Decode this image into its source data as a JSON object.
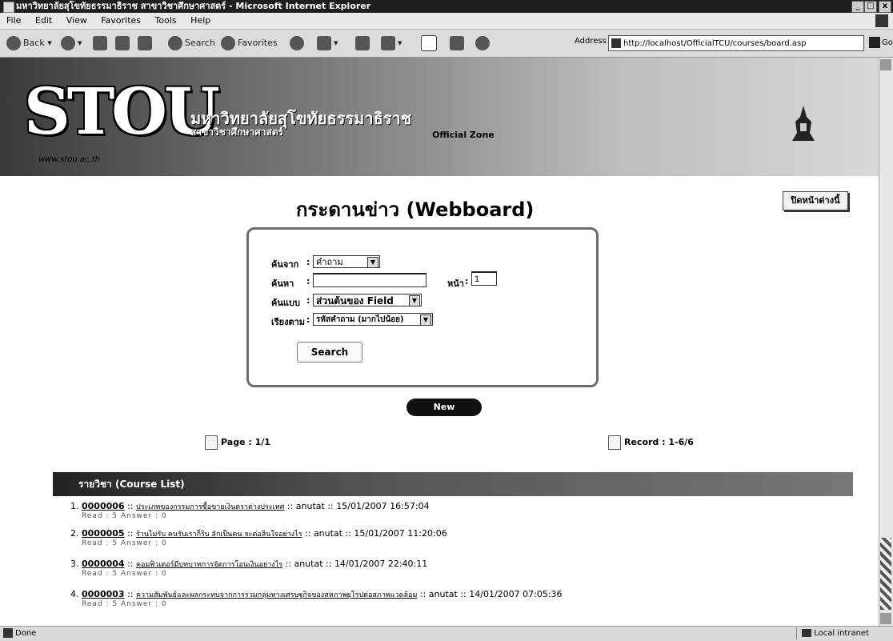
{
  "window": {
    "title": "มหาวิทยาลัยสุโขทัยธรรมาธิราช สาขาวิชาศึกษาศาสตร์ - Microsoft Internet Explorer",
    "min": "_",
    "max": "□",
    "close": "x"
  },
  "menu": [
    "File",
    "Edit",
    "View",
    "Favorites",
    "Tools",
    "Help"
  ],
  "toolbar": {
    "back": "Back",
    "search": "Search",
    "favorites": "Favorites",
    "address_label": "Address",
    "address": "http://localhost/OfficialTCU/courses/board.asp",
    "go": "Go"
  },
  "banner": {
    "logo": "STOU",
    "site_url": "www.stou.ac.th",
    "university": "มหาวิทยาลัยสุโขทัยธรรมาธิราช",
    "school": "สาขาวิชาศึกษาศาสตร์",
    "zone": "Official Zone"
  },
  "page": {
    "title": "กระดานข่าว (Webboard)",
    "print_button": "ปิดหน้าต่างนี้"
  },
  "search": {
    "from_label": "ค้นจาก",
    "from_value": "คำถาม",
    "find_label": "ค้นหา",
    "find_value": "",
    "page_label": "หน้า",
    "page_value": "1",
    "mode_label": "ค้นแบบ",
    "mode_value": "ส่วนต้นของ Field",
    "sort_label": "เรียงตาม",
    "sort_value": "รหัสคำถาม (มากไปน้อย)",
    "button": "Search"
  },
  "new_button": "New",
  "paging": {
    "page": "Page : 1/1",
    "record": "Record : 1-6/6"
  },
  "course_list": {
    "header": "รายวิชา (Course List)",
    "items": [
      {
        "num": "1.",
        "code": "0000006",
        "subject": "ประเภทของกรรมการซื้อขายเงินตราต่างประเทศ",
        "author": "anutat",
        "date": "15/01/2007 16:57:04",
        "meta": "Read : 5   Answer : 0"
      },
      {
        "num": "2.",
        "code": "0000005",
        "subject": "ร้านไม่รับ คนรับเราก็ริบ ลักเป็นคน จะต่อสินใจอย่างไร",
        "author": "anutat",
        "date": "15/01/2007 11:20:06",
        "meta": "Read : 5   Answer : 0"
      },
      {
        "num": "3.",
        "code": "0000004",
        "subject": "คอมพิวเตอร์มีบทบาทการจัดการโอนเงินอย่างไร",
        "author": "anutat",
        "date": "14/01/2007 22:40:11",
        "meta": "Read : 5   Answer : 0"
      },
      {
        "num": "4.",
        "code": "0000003",
        "subject": "ความสัมพันธ์และผลกระทบจากการรวมกลุ่มทางเศรษฐกิจของสหภาพยุโรปต่อสภาพแวดล้อม",
        "author": "anutat",
        "date": "14/01/2007 07:05:36",
        "meta": "Read : 5   Answer : 0"
      }
    ]
  },
  "status": {
    "text": "Done",
    "zone": "Local intranet"
  }
}
